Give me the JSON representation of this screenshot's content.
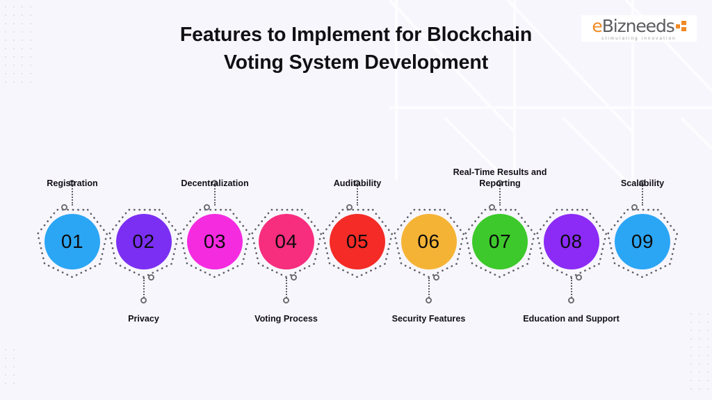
{
  "header": {
    "title_line1": "Features to Implement for Blockchain",
    "title_line2": "Voting System Development"
  },
  "logo": {
    "name_prefix": "e",
    "name_rest": "Bizneeds",
    "tagline": "stimulating innovation",
    "prefix_color": "#f08a26",
    "rest_color": "#5b5b60",
    "mark_color": "#f08a26"
  },
  "theme": {
    "background": "#f8f6fd",
    "text_color": "#111014",
    "connector_color": "#5c5c63",
    "dot_grid_color": "#cfc7e4"
  },
  "steps": [
    {
      "number": "01",
      "label": "Registration",
      "color": "#2ba6f5",
      "position": "above"
    },
    {
      "number": "02",
      "label": "Privacy",
      "color": "#7b2ff2",
      "position": "below"
    },
    {
      "number": "03",
      "label": "Decentralization",
      "color": "#f52be0",
      "position": "above"
    },
    {
      "number": "04",
      "label": "Voting Process",
      "color": "#f72d7d",
      "position": "below"
    },
    {
      "number": "05",
      "label": "Auditability",
      "color": "#f42b26",
      "position": "above"
    },
    {
      "number": "06",
      "label": "Security Features",
      "color": "#f5b335",
      "position": "below"
    },
    {
      "number": "07",
      "label": "Real-Time Results and Reporting",
      "color": "#3dc92b",
      "position": "above"
    },
    {
      "number": "08",
      "label": "Education and Support",
      "color": "#8b2bf5",
      "position": "below"
    },
    {
      "number": "09",
      "label": "Scalability",
      "color": "#2ba6f5",
      "position": "above"
    }
  ]
}
